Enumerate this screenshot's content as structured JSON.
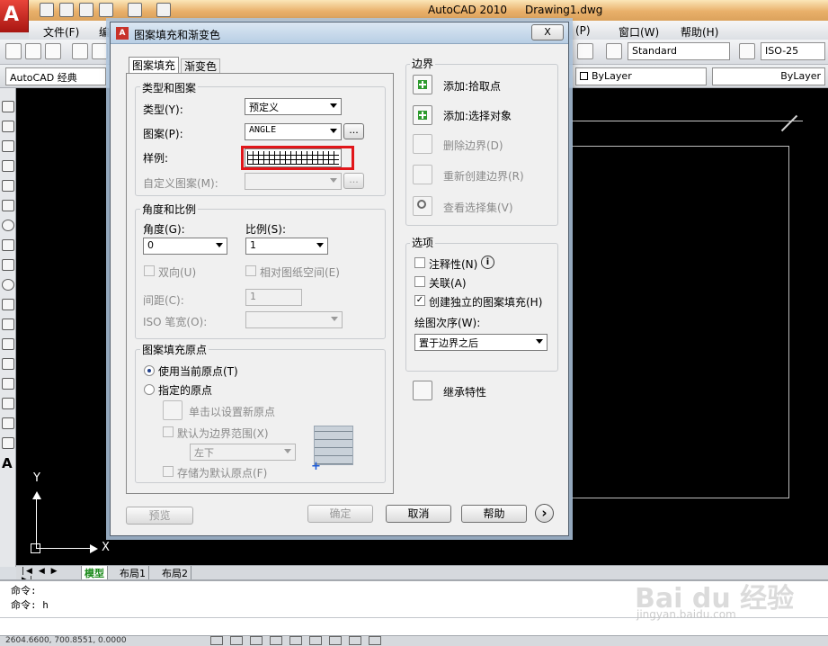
{
  "app": {
    "window_title": "AutoCAD 2010",
    "drawing_name": "Drawing1.dwg",
    "menu": [
      "文件(F)",
      "编",
      "(P)",
      "窗口(W)",
      "帮助(H)"
    ],
    "workspace": "AutoCAD 经典",
    "text_style": "Standard",
    "dim_style": "ISO-25",
    "layer_color": "ByLayer",
    "layer_linetype": "ByLayer",
    "axis_y": "Y",
    "axis_x": "X"
  },
  "layout_tabs": [
    "模型",
    "布局1",
    "布局2"
  ],
  "command_lines": [
    "命令:",
    "命令: h"
  ],
  "status_coords": "2604.6600, 700.8551, 0.0000",
  "watermark": {
    "brand": "Bai du 经验",
    "url": "jingyan.baidu.com"
  },
  "dialog": {
    "title": "图案填充和渐变色",
    "close": "X",
    "tabs": [
      "图案填充",
      "渐变色"
    ],
    "type_pattern": {
      "group": "类型和图案",
      "type_label": "类型(Y):",
      "type_value": "预定义",
      "pattern_label": "图案(P):",
      "pattern_value": "ANGLE",
      "browse": "...",
      "sample_label": "样例:",
      "custom_label": "自定义图案(M):"
    },
    "angle_scale": {
      "group": "角度和比例",
      "angle_label": "角度(G):",
      "angle_value": "0",
      "scale_label": "比例(S):",
      "scale_value": "1",
      "double_label": "双向(U)",
      "relative_label": "相对图纸空间(E)",
      "spacing_label": "间距(C):",
      "spacing_value": "1",
      "iso_label": "ISO 笔宽(O):"
    },
    "origin": {
      "group": "图案填充原点",
      "use_current": "使用当前原点(T)",
      "specified": "指定的原点",
      "click_set": "单击以设置新原点",
      "default_extent": "默认为边界范围(X)",
      "position_value": "左下",
      "store_default": "存储为默认原点(F)"
    },
    "boundaries": {
      "group": "边界",
      "add_pick": "添加:拾取点",
      "add_select": "添加:选择对象",
      "remove": "删除边界(D)",
      "recreate": "重新创建边界(R)",
      "view_sel": "查看选择集(V)"
    },
    "options": {
      "group": "选项",
      "annotative": "注释性(N)",
      "associative": "关联(A)",
      "independent": "创建独立的图案填充(H)",
      "draw_order_label": "绘图次序(W):",
      "draw_order_value": "置于边界之后"
    },
    "inherit": "继承特性",
    "buttons": {
      "preview": "预览",
      "ok": "确定",
      "cancel": "取消",
      "help": "帮助",
      "more": "›"
    }
  }
}
